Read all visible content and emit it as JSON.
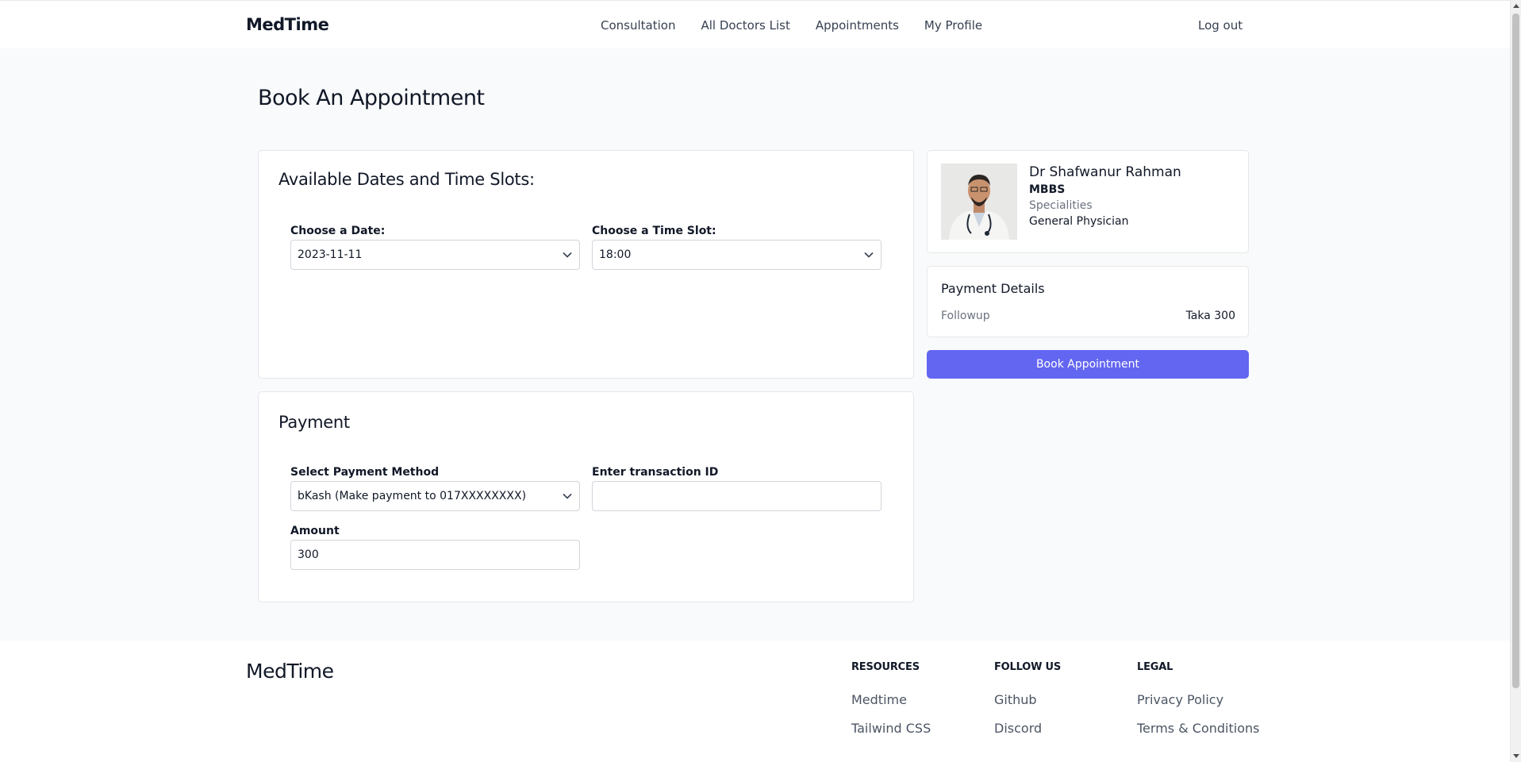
{
  "header": {
    "brand": "MedTime",
    "nav": [
      "Consultation",
      "All Doctors List",
      "Appointments",
      "My Profile"
    ],
    "logout": "Log out"
  },
  "page_title": "Book An Appointment",
  "slots": {
    "heading": "Available Dates and Time Slots:",
    "date_label": "Choose a Date:",
    "date_value": "2023-11-11",
    "time_label": "Choose a Time Slot:",
    "time_value": "18:00"
  },
  "payment": {
    "heading": "Payment",
    "method_label": "Select Payment Method",
    "method_value": "bKash (Make payment to 017XXXXXXXX)",
    "txn_label": "Enter transaction ID",
    "txn_value": "",
    "amount_label": "Amount",
    "amount_value": "300"
  },
  "doctor": {
    "name": "Dr Shafwanur Rahman",
    "degree": "MBBS",
    "specialities_label": "Specialities",
    "speciality": "General Physician"
  },
  "payment_details": {
    "title": "Payment Details",
    "type": "Followup",
    "amount": "Taka 300"
  },
  "book_button": "Book Appointment",
  "footer": {
    "brand": "MedTime",
    "columns": [
      {
        "heading": "RESOURCES",
        "links": [
          "Medtime",
          "Tailwind CSS"
        ]
      },
      {
        "heading": "FOLLOW US",
        "links": [
          "Github",
          "Discord"
        ]
      },
      {
        "heading": "LEGAL",
        "links": [
          "Privacy Policy",
          "Terms & Conditions"
        ]
      }
    ]
  },
  "colors": {
    "accent": "#6366f1",
    "background": "#f9fafb",
    "card": "#ffffff",
    "border": "#e5e7eb"
  }
}
